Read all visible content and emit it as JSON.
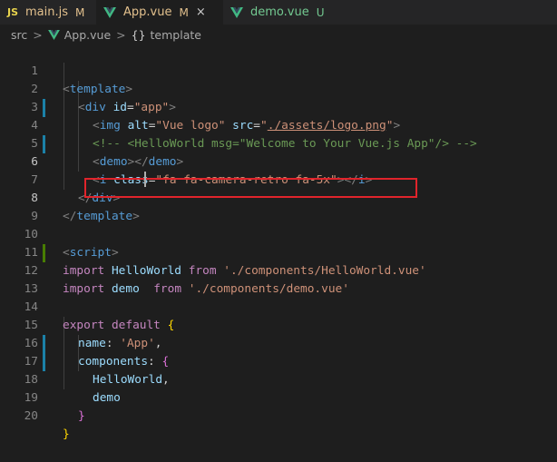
{
  "tabs": [
    {
      "badge": "JS",
      "name": "main.js",
      "status": "M",
      "active": false
    },
    {
      "name": "App.vue",
      "status": "M",
      "active": true,
      "close": "×"
    },
    {
      "name": "demo.vue",
      "status": "U",
      "active": false
    }
  ],
  "breadcrumb": {
    "segments": [
      "src",
      "App.vue",
      "template"
    ],
    "sep": ">",
    "symbol": "{}"
  },
  "line_numbers": [
    "1",
    "2",
    "3",
    "4",
    "5",
    "6",
    "7",
    "8",
    "9",
    "10",
    "11",
    "12",
    "13",
    "14",
    "15",
    "16",
    "17",
    "18",
    "19",
    "20"
  ],
  "code": {
    "l1": {
      "open": "<",
      "tag": "template",
      "close": ">"
    },
    "l2": {
      "open": "<",
      "tag": "div",
      "attr": "id",
      "eq": "=",
      "val": "\"app\"",
      "close": ">"
    },
    "l3": {
      "open": "<",
      "tag": "img",
      "attr1": "alt",
      "val1": "\"Vue logo\"",
      "attr2": "src",
      "q1": "\"",
      "path": "./assets/logo.png",
      "q2": "\"",
      "close": ">"
    },
    "l4": {
      "comment": "<!-- <HelloWorld msg=\"Welcome to Your Vue.js App\"/> -->"
    },
    "l5": {
      "open": "<",
      "tag": "demo",
      "mid": "></",
      "tag2": "demo",
      "close": ">"
    },
    "l6": {
      "open": "<",
      "tag": "i",
      "attr": "class",
      "eq": "=",
      "val": "\"fa fa-camera-retro fa-5x\"",
      "mid": "></",
      "tag2": "i",
      "close": ">"
    },
    "l7": {
      "open": "</",
      "tag": "div",
      "close": ">"
    },
    "l8": {
      "open": "</",
      "tag": "template",
      "close": ">"
    },
    "l10": {
      "open": "<",
      "tag": "script",
      "close": ">"
    },
    "l11": {
      "kw1": "import",
      "name": "HelloWorld",
      "kw2": "from",
      "src": "'./components/HelloWorld.vue'"
    },
    "l12": {
      "kw1": "import",
      "name": "demo",
      "kw2": "from",
      "src": "'./components/demo.vue'"
    },
    "l14": {
      "kw1": "export",
      "kw2": "default",
      "brace": "{"
    },
    "l15": {
      "key": "name",
      "colon": ":",
      "val": "'App'",
      "comma": ","
    },
    "l16": {
      "key": "components",
      "colon": ":",
      "brace": "{"
    },
    "l17": {
      "name": "HelloWorld",
      "comma": ","
    },
    "l18": {
      "name": "demo"
    },
    "l19": {
      "brace": "}"
    },
    "l20": {
      "brace": "}"
    }
  },
  "colors": {
    "background": "#1e1e1e",
    "tag": "#569cd6",
    "attribute": "#9cdcfe",
    "string": "#ce9178",
    "comment": "#6a9955",
    "keyword": "#c586c0",
    "highlight_box": "#e0242b",
    "modified": "#e2c08d",
    "untracked": "#73c991"
  },
  "icons": {
    "vue": "vue-logo-icon",
    "close": "close-icon",
    "chevron": "chevron-right-icon",
    "symbol": "braces-icon"
  }
}
